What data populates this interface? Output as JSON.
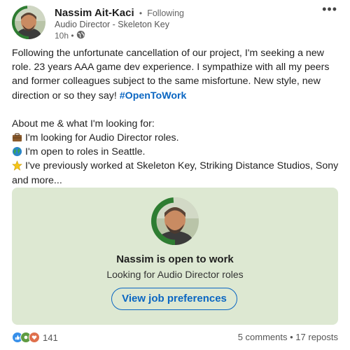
{
  "author": {
    "name": "Nassim Ait-Kaci",
    "separator": "•",
    "following": "Following",
    "headline": "Audio Director - Skeleton Key",
    "time": "10h •",
    "badge": "#OPENTOWORK"
  },
  "post": {
    "line1": "Following the unfortunate cancellation of our project, I'm seeking a new role. 23 years AAA game dev experience. I sympathize with all my peers and former colleagues subject to the same misfortune. New style, new direction or so they say!",
    "hashtag": "#OpenToWork",
    "intro": "About me & what I'm looking for:",
    "bullets": [
      {
        "icon": "briefcase-icon",
        "text": "I'm looking for Audio Director roles."
      },
      {
        "icon": "globe-icon",
        "text": "I'm open to roles in Seattle."
      },
      {
        "icon": "star-icon",
        "text": "I've previously worked at Skeleton Key, Striking Distance Studios, Sony"
      }
    ],
    "see_more": "and more..."
  },
  "open_to_work": {
    "title": "Nassim is open to work",
    "subtitle": "Looking for Audio Director roles",
    "button": "View job preferences",
    "background": "#dde8d2"
  },
  "footer": {
    "reaction_count": "141",
    "comments": "5 comments",
    "separator": " • ",
    "reposts": "17 reposts"
  },
  "colors": {
    "accent": "#0a66c2",
    "opentowork_green": "#2e7d32"
  }
}
